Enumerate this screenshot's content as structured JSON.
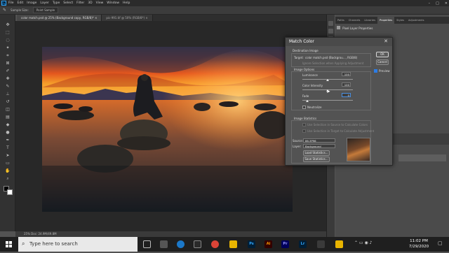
{
  "app": {
    "logo": "Ps",
    "menu": [
      "File",
      "Edit",
      "Image",
      "Layer",
      "Type",
      "Select",
      "Filter",
      "3D",
      "View",
      "Window",
      "Help"
    ],
    "window_controls": [
      "–",
      "□",
      "✕"
    ]
  },
  "options_bar": {
    "sample_size": "Sample Size:",
    "sample_value": "Point Sample"
  },
  "document_tabs": [
    {
      "label": "color match.psd @ 25% (Background copy, RGB/8)*",
      "close": "×",
      "active": true
    },
    {
      "label": "pic-991.tif @ 50% (RGB/8*)",
      "close": "×",
      "active": false
    }
  ],
  "status_bar": {
    "text": "25%     Doc: 24.9M/49.8M"
  },
  "panel": {
    "tabs": [
      "Paths",
      "Channels",
      "Libraries",
      "Properties",
      "Styles",
      "Adjustments"
    ],
    "active_tab": "Properties",
    "title": "Pixel Layer Properties"
  },
  "dialog": {
    "title": "Match Color",
    "close": "✕",
    "destination_heading": "Destination Image",
    "target_label": "Target:",
    "target_value": "color match.psd (Backgrou..., RGB/8)",
    "ignore_selection": "Ignore Selection when Applying Adjustment",
    "image_options_heading": "Image Options",
    "luminance_label": "Luminance",
    "luminance_value": "100",
    "color_intensity_label": "Color Intensity",
    "color_intensity_value": "100",
    "fade_label": "Fade",
    "fade_value": "0",
    "neutralize_label": "Neutralize",
    "image_statistics_heading": "Image Statistics",
    "use_selection_source": "Use Selection in Source to Calculate Colors",
    "use_selection_target": "Use Selection in Target to Calculate Adjustment",
    "source_label": "Source:",
    "source_value": "86.3P96",
    "layer_label": "Layer:",
    "layer_value": "Background",
    "load_stats": "Load Statistics...",
    "save_stats": "Save Statistics...",
    "ok": "OK",
    "cancel": "Cancel",
    "preview": "Preview",
    "preview_checked": true
  },
  "taskbar": {
    "search_placeholder": "Type here to search",
    "apps": [
      {
        "name": "ps",
        "label": "Ps",
        "color": "#31a8ff",
        "bg": "#001e36"
      },
      {
        "name": "ai",
        "label": "Ai",
        "color": "#ff9a00",
        "bg": "#330000"
      },
      {
        "name": "pr",
        "label": "Pr",
        "color": "#9999ff",
        "bg": "#00005b"
      },
      {
        "name": "lr",
        "label": "Lr",
        "color": "#31a8ff",
        "bg": "#001e36"
      }
    ],
    "time": "11:02 PM",
    "date": "7/29/2020"
  }
}
